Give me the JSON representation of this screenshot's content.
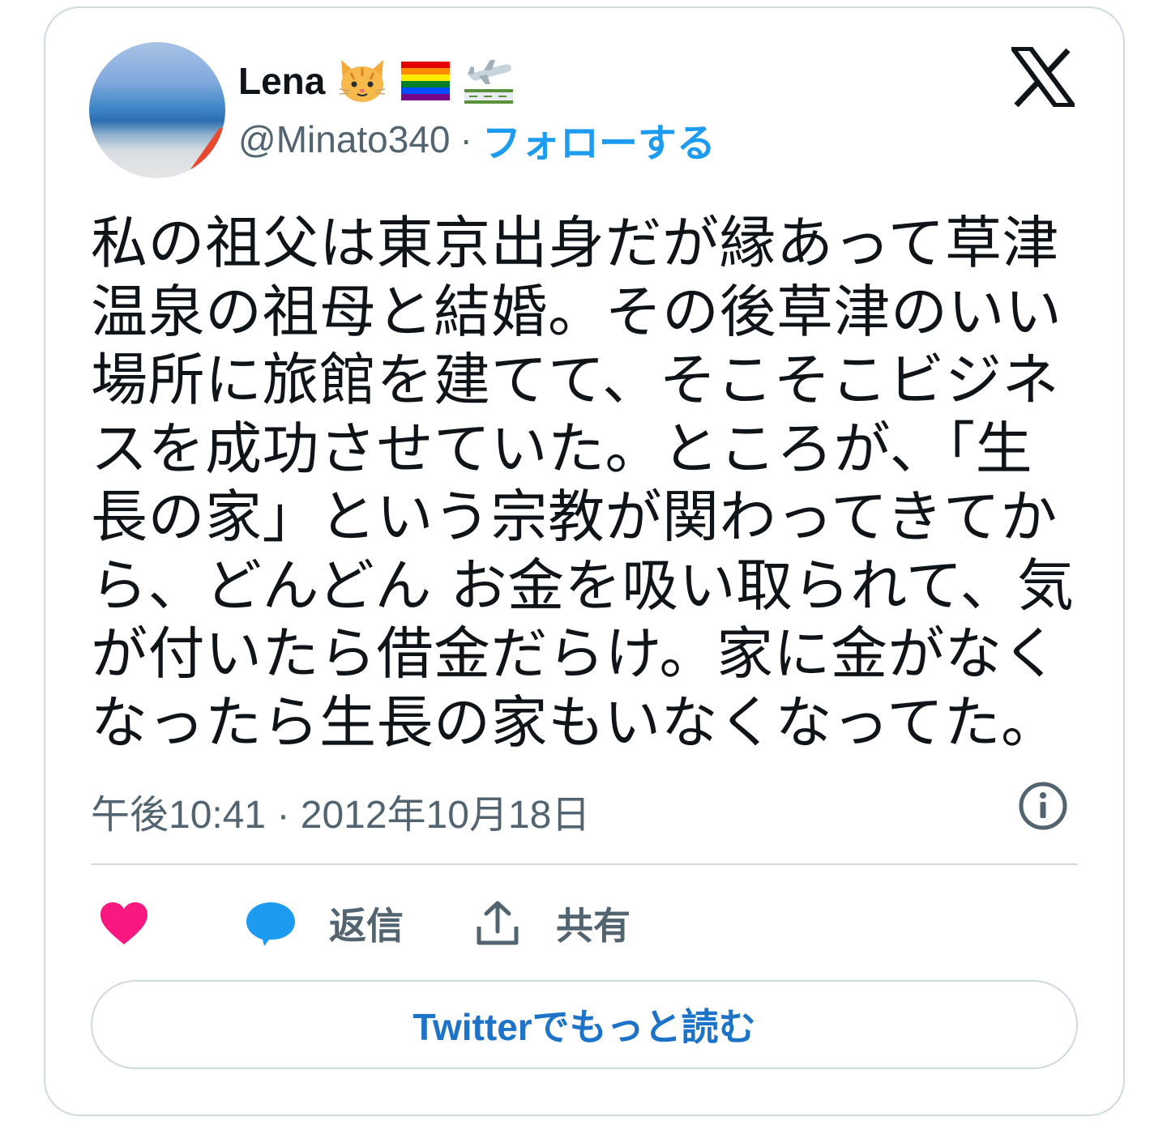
{
  "user": {
    "name": "Lena",
    "badges": [
      "cat-face-emoji",
      "rainbow-flag-emoji",
      "airplane-emoji"
    ],
    "handle": "@Minato340",
    "separator": "·",
    "follow_label": "フォローする"
  },
  "tweet": {
    "lines": [
      "私の祖父は東京出身だが縁あって草津",
      "温泉の祖母と結婚。その後草津のいい",
      "場所に旅館を建てて、そこそこビジネ",
      "スを成功させていた。ところが、「生",
      "長の家」という宗教が関わってきてか",
      "ら、どんどん お金を吸い取られて、気",
      "が付いたら借金だらけ。家に金がなく",
      "なったら生長の家もいなくなってた。"
    ],
    "timestamp": "午後10:41 · 2012年10月18日"
  },
  "actions": {
    "like_icon": "heart-icon",
    "reply_label": "返信",
    "share_label": "共有"
  },
  "cta": {
    "read_more_label": "Twitterでもっと読む"
  },
  "colors": {
    "accent": "#1d9bf0",
    "heart": "#f91880",
    "muted": "#536471",
    "text": "#0f1419",
    "border": "#cfd9de"
  }
}
